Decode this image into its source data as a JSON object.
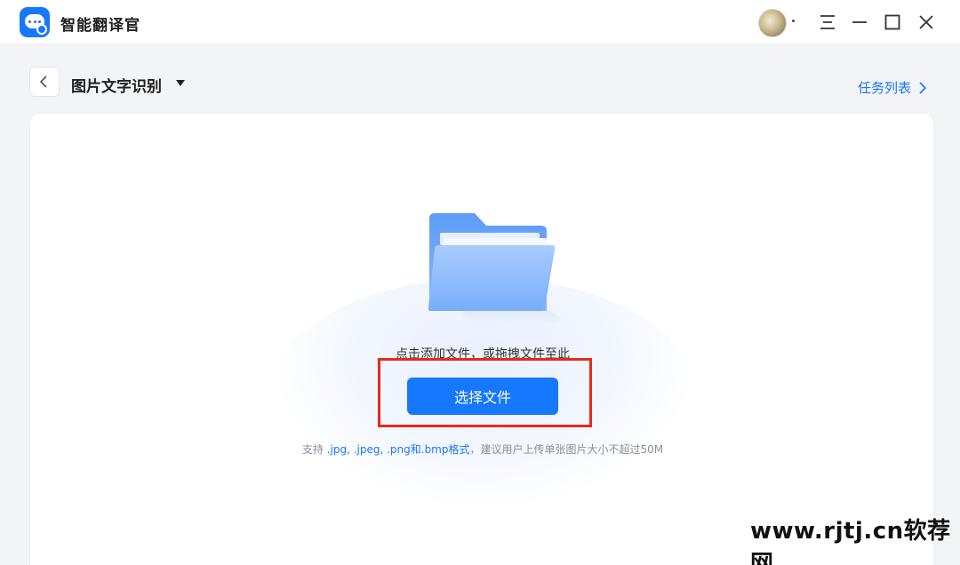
{
  "app": {
    "title": "智能翻译官"
  },
  "header": {
    "title": "图片文字识别",
    "task_list_label": "任务列表"
  },
  "upload": {
    "drop_hint": "点击添加文件，或拖拽文件至此",
    "select_button_label": "选择文件",
    "support_prefix": "支持 ",
    "support_formats": ".jpg, .jpeg, .png和.bmp格式",
    "support_suffix": "，建议用户上传单张图片大小不超过50M"
  },
  "watermark": "www.rjtj.cn软荐网",
  "colors": {
    "accent": "#1677ff",
    "highlight_border": "#e8291c",
    "background": "#f3f4f7"
  },
  "icons": {
    "logo": "chat-bubble-logo",
    "menu": "menu-icon",
    "minimize": "minimize-icon",
    "maximize": "maximize-icon",
    "close": "close-icon",
    "back": "chevron-left-icon",
    "caret": "caret-down-icon",
    "folder": "folder-icon"
  }
}
